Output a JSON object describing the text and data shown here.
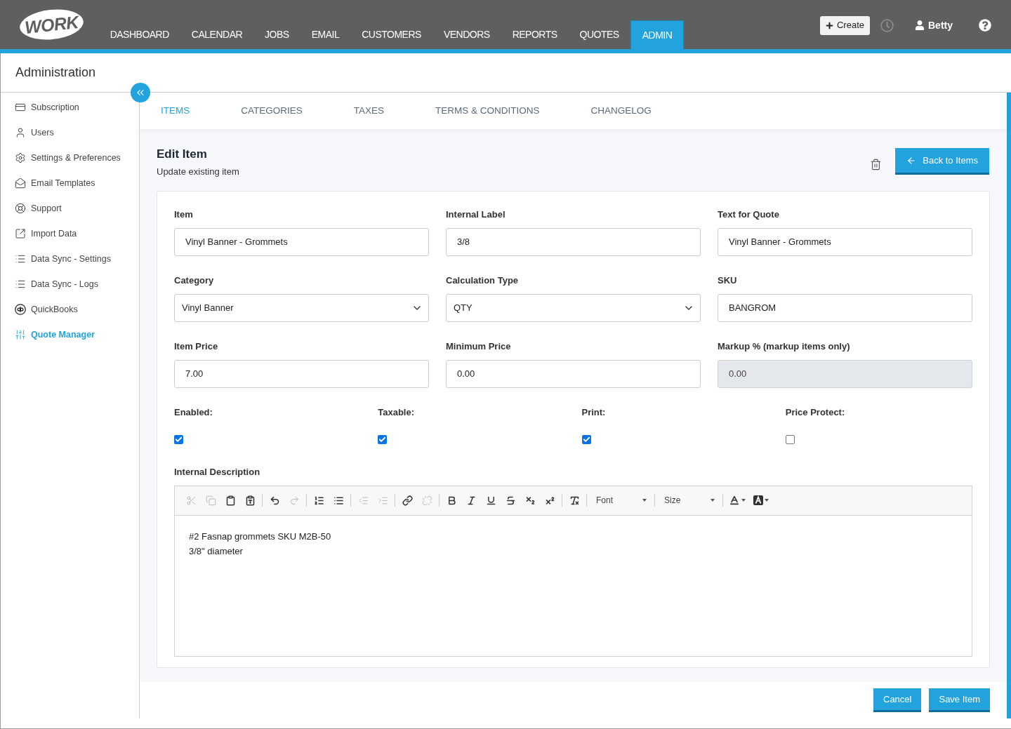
{
  "navbar": {
    "logo": "WORK",
    "items": [
      {
        "label": "DASHBOARD",
        "selected": false
      },
      {
        "label": "CALENDAR",
        "selected": false
      },
      {
        "label": "JOBS",
        "selected": false
      },
      {
        "label": "EMAIL",
        "selected": false
      },
      {
        "label": "CUSTOMERS",
        "selected": false
      },
      {
        "label": "VENDORS",
        "selected": false
      },
      {
        "label": "REPORTS",
        "selected": false
      },
      {
        "label": "QUOTES",
        "selected": false
      },
      {
        "label": "ADMIN",
        "selected": true
      }
    ],
    "create_button": "Create",
    "user": "Betty"
  },
  "page_title": "Administration",
  "sidebar": {
    "items": [
      {
        "label": "Subscription",
        "selected": false
      },
      {
        "label": "Users",
        "selected": false
      },
      {
        "label": "Settings & Preferences",
        "selected": false
      },
      {
        "label": "Email Templates",
        "selected": false
      },
      {
        "label": "Support",
        "selected": false
      },
      {
        "label": "Import Data",
        "selected": false
      },
      {
        "label": "Data Sync - Settings",
        "selected": false
      },
      {
        "label": "Data Sync - Logs",
        "selected": false
      },
      {
        "label": "QuickBooks",
        "selected": false
      },
      {
        "label": "Quote Manager",
        "selected": true
      }
    ]
  },
  "tabs": [
    {
      "label": "ITEMS",
      "selected": true
    },
    {
      "label": "CATEGORIES",
      "selected": false
    },
    {
      "label": "TAXES",
      "selected": false
    },
    {
      "label": "TERMS & CONDITIONS",
      "selected": false
    },
    {
      "label": "CHANGELOG",
      "selected": false
    }
  ],
  "header": {
    "title": "Edit Item",
    "subtitle": "Update existing item",
    "back_button": "Back to Items"
  },
  "fields": [
    {
      "label": "Item",
      "kind": "text",
      "value": "Vinyl Banner - Grommets",
      "disabled": false
    },
    {
      "label": "Internal Label",
      "kind": "text",
      "value": "3/8",
      "disabled": false
    },
    {
      "label": "Text for Quote",
      "kind": "text",
      "value": "Vinyl Banner - Grommets",
      "disabled": false
    },
    {
      "label": "Category",
      "kind": "select",
      "value": "Vinyl Banner",
      "disabled": false
    },
    {
      "label": "Calculation Type",
      "kind": "select",
      "value": "QTY",
      "disabled": false
    },
    {
      "label": "SKU",
      "kind": "text",
      "value": "BANGROM",
      "disabled": false
    },
    {
      "label": "Item Price",
      "kind": "text",
      "value": "7.00",
      "disabled": false
    },
    {
      "label": "Minimum Price",
      "kind": "text",
      "value": "0.00",
      "disabled": false
    },
    {
      "label": "Markup % (markup items only)",
      "kind": "text",
      "value": "0.00",
      "disabled": true
    }
  ],
  "checkboxes": [
    {
      "label": "Enabled:",
      "checked": true
    },
    {
      "label": "Taxable:",
      "checked": true
    },
    {
      "label": "Print:",
      "checked": true
    },
    {
      "label": "Price Protect:",
      "checked": false
    }
  ],
  "description": {
    "label": "Internal Description",
    "toolbar": {
      "groups": [
        [
          {
            "disabled": true
          },
          {
            "disabled": true
          },
          {
            "disabled": false
          },
          {
            "disabled": false
          }
        ],
        [
          {
            "disabled": false
          },
          {
            "disabled": true
          }
        ],
        [
          {
            "disabled": false
          },
          {
            "disabled": false
          }
        ],
        [
          {
            "disabled": true
          },
          {
            "disabled": true
          }
        ],
        [
          {
            "disabled": false
          },
          {
            "disabled": true
          }
        ],
        [
          {
            "disabled": false
          },
          {
            "disabled": false
          },
          {
            "disabled": false
          },
          {
            "disabled": false
          },
          {
            "disabled": false
          },
          {
            "disabled": false
          }
        ],
        [
          {
            "disabled": false
          }
        ]
      ],
      "font": "Font",
      "size": "Size",
      "color_buttons": [
        {
          "disabled": false
        },
        {
          "disabled": false
        }
      ]
    },
    "lines": [
      "#2 Fasnap grommets SKU M2B-50",
      "3/8\" diameter"
    ]
  },
  "footer": {
    "cancel": "Cancel",
    "save": "Save Item"
  }
}
